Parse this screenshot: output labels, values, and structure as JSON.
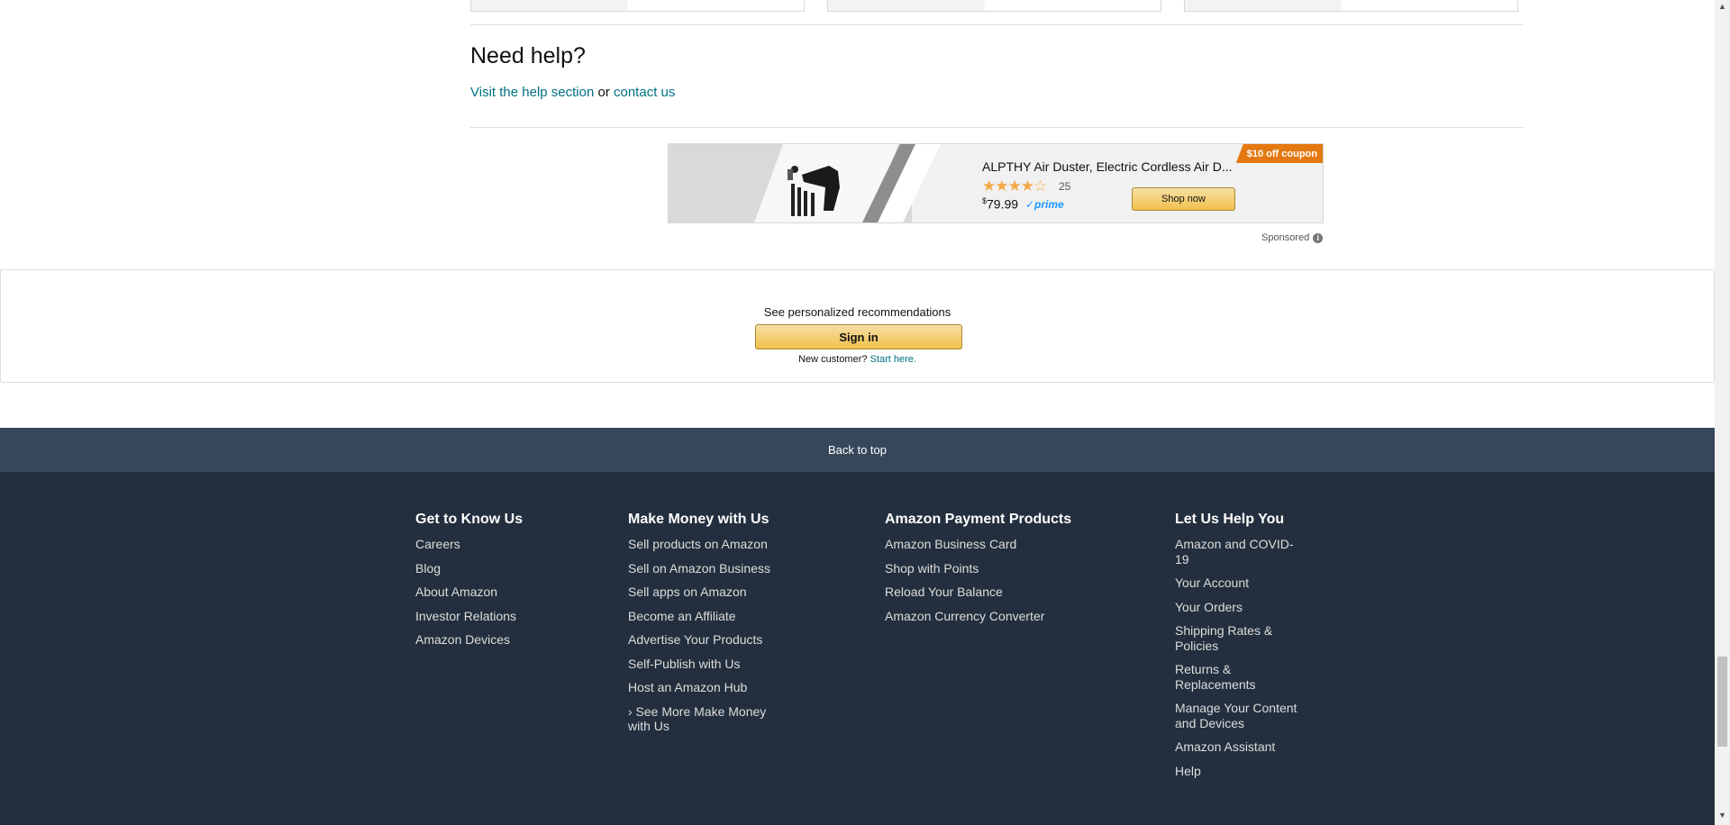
{
  "help": {
    "title": "Need help?",
    "visit_link": "Visit the help section",
    "or_text": "or",
    "contact_link": "contact us"
  },
  "ad": {
    "title": "ALPTHY Air Duster, Electric Cordless Air D...",
    "stars": "★★★★☆",
    "rating_count": "25",
    "price_currency": "$",
    "price": "79.99",
    "prime": "✓prime",
    "shop_button": "Shop now",
    "coupon": "$10 off coupon",
    "sponsored": "Sponsored",
    "info_icon": "i"
  },
  "recommendations": {
    "title": "See personalized recommendations",
    "sign_in": "Sign in",
    "new_customer": "New customer?",
    "start_here": "Start here."
  },
  "back_to_top": "Back to top",
  "footer": {
    "columns": [
      {
        "heading": "Get to Know Us",
        "items": [
          "Careers",
          "Blog",
          "About Amazon",
          "Investor Relations",
          "Amazon Devices"
        ]
      },
      {
        "heading": "Make Money with Us",
        "items": [
          "Sell products on Amazon",
          "Sell on Amazon Business",
          "Sell apps on Amazon",
          "Become an Affiliate",
          "Advertise Your Products",
          "Self-Publish with Us",
          "Host an Amazon Hub",
          "› See More Make Money with Us"
        ]
      },
      {
        "heading": "Amazon Payment Products",
        "items": [
          "Amazon Business Card",
          "Shop with Points",
          "Reload Your Balance",
          "Amazon Currency Converter"
        ]
      },
      {
        "heading": "Let Us Help You",
        "items": [
          "Amazon and COVID-19",
          "Your Account",
          "Your Orders",
          "Shipping Rates & Policies",
          "Returns & Replacements",
          "Manage Your Content and Devices",
          "Amazon Assistant",
          "Help"
        ]
      }
    ]
  },
  "scrollbar": {
    "up": "▲",
    "down": "▼"
  }
}
